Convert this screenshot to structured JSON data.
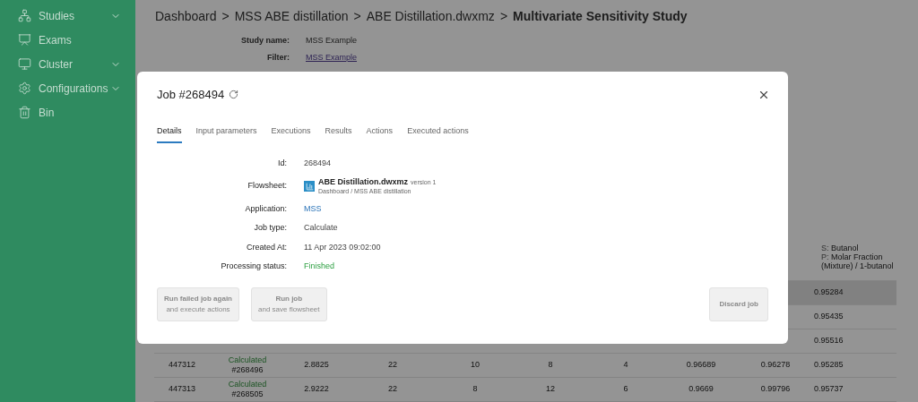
{
  "sidebar": {
    "items": [
      {
        "label": "Studies",
        "expandable": true
      },
      {
        "label": "Exams",
        "expandable": false
      },
      {
        "label": "Cluster",
        "expandable": true
      },
      {
        "label": "Configurations",
        "expandable": true
      },
      {
        "label": "Bin",
        "expandable": false
      }
    ]
  },
  "breadcrumb": {
    "items": [
      "Dashboard",
      "MSS ABE distillation",
      "ABE Distillation.dwxmz"
    ],
    "separator": ">",
    "current": "Multivariate Sensitivity Study"
  },
  "study_info": [
    {
      "label": "Study name:",
      "value": "MSS Example",
      "kind": "text"
    },
    {
      "label": "Filter:",
      "value": "MSS Example",
      "kind": "link"
    }
  ],
  "table": {
    "header_last": {
      "s_label": "S:",
      "s_value": "Butanol",
      "p_label": "P:",
      "p_value": "Molar Fraction (Mixture) / 1-butanol"
    },
    "rows": [
      {
        "selected": true,
        "cells": [
          "",
          "",
          "",
          "",
          "",
          "",
          "",
          "",
          "",
          "0.95284"
        ]
      },
      {
        "selected": false,
        "cells": [
          "",
          "",
          "",
          "",
          "",
          "",
          "",
          "",
          "",
          "0.95435"
        ]
      },
      {
        "selected": false,
        "cells": [
          "",
          "",
          "",
          "",
          "",
          "",
          "",
          "",
          "",
          "0.95516"
        ]
      },
      {
        "selected": false,
        "cells": [
          "447312",
          {
            "status": "Calculated",
            "job": "#268496"
          },
          "2.8825",
          "22",
          "10",
          "8",
          "4",
          "0.96689",
          "0.96278",
          "0.95285"
        ]
      },
      {
        "selected": false,
        "cells": [
          "447313",
          {
            "status": "Calculated",
            "job": "#268505"
          },
          "2.9222",
          "22",
          "8",
          "12",
          "6",
          "0.9669",
          "0.99796",
          "0.95737"
        ]
      }
    ]
  },
  "dialog": {
    "title": "Job #268494",
    "tabs": [
      {
        "label": "Details",
        "selected": true
      },
      {
        "label": "Input parameters",
        "selected": false
      },
      {
        "label": "Executions",
        "selected": false
      },
      {
        "label": "Results",
        "selected": false
      },
      {
        "label": "Actions",
        "selected": false
      },
      {
        "label": "Executed actions",
        "selected": false
      }
    ],
    "details": [
      {
        "kind": "text",
        "label": "Id:",
        "value": "268494"
      },
      {
        "kind": "flowsheet",
        "label": "Flowsheet:",
        "value": "ABE Distillation.dwxmz",
        "version": "version 1",
        "path": "Dashboard / MSS ABE distillation"
      },
      {
        "kind": "link",
        "label": "Application:",
        "value": "MSS"
      },
      {
        "kind": "text",
        "label": "Job type:",
        "value": "Calculate"
      },
      {
        "kind": "text",
        "label": "Created At:",
        "value": "11 Apr 2023 09:02:00"
      },
      {
        "kind": "status",
        "label": "Processing status:",
        "value": "Finished"
      }
    ],
    "buttons": [
      {
        "line1": "Run failed job again",
        "line2": "and execute actions",
        "disabled": true
      },
      {
        "line1": "Run job",
        "line2": "and save flowsheet",
        "disabled": true
      },
      {
        "line1": "Discard job",
        "disabled": true
      }
    ]
  }
}
